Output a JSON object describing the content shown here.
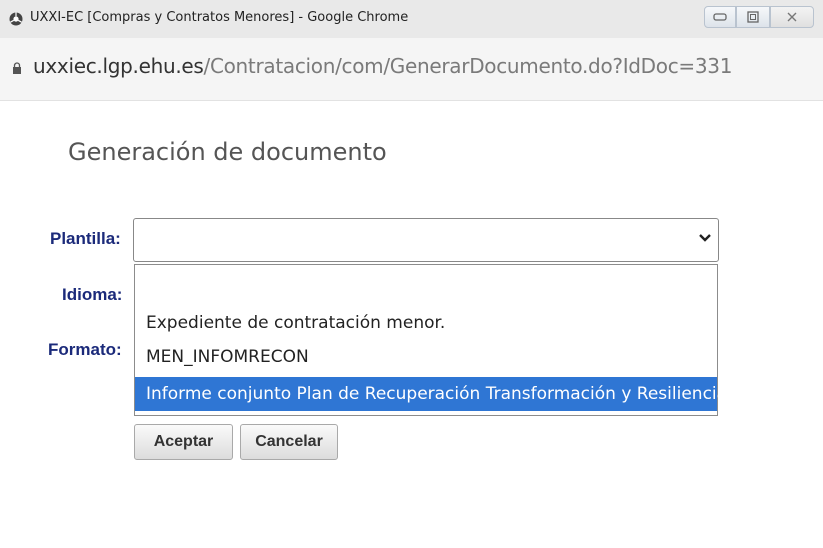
{
  "window": {
    "title": "UXXI-EC [Compras y Contratos Menores] - Google Chrome",
    "buttons": [
      "minimize",
      "maximize",
      "close"
    ]
  },
  "urlbar": {
    "host": "uxxiec.lgp.ehu.es",
    "path": "/Contratacion/com/GenerarDocumento.do?IdDoc=331"
  },
  "page": {
    "title": "Generación de documento"
  },
  "form": {
    "plantilla_label": "Plantilla:",
    "idioma_label": "Idioma:",
    "formato_label": "Formato:",
    "plantilla_value": "",
    "options": [
      "",
      "Expediente de contratación menor.",
      "MEN_INFOMRECON",
      "Informe conjunto Plan de Recuperación Transformación y Resiliencia"
    ],
    "highlighted_option_index": 3,
    "accept_label": "Aceptar",
    "cancel_label": "Cancelar"
  },
  "colors": {
    "highlight": "#2f76d4",
    "label": "#1b2a7a"
  }
}
